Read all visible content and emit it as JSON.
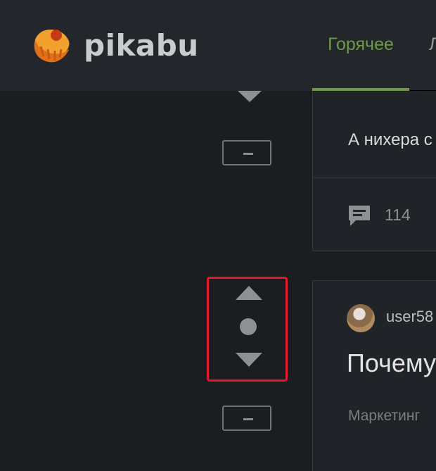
{
  "header": {
    "brand": "pikabu",
    "tabs": [
      {
        "label": "Горячее",
        "active": true
      },
      {
        "label": "Л",
        "active": false
      }
    ]
  },
  "posts": [
    {
      "title": "А нихера с",
      "comments_count": "114"
    },
    {
      "author": "user58",
      "title": "Почему",
      "tag": "Маркетинг"
    }
  ],
  "colors": {
    "accent_green": "#6b9a4a",
    "highlight_red": "#e0192c",
    "background": "#1b1d20",
    "header_bg": "#23262a"
  },
  "icons": {
    "logo": "pikabu-cupcake-icon",
    "comment": "comment-bubble-icon",
    "vote_up": "triangle-up-icon",
    "vote_down": "triangle-down-icon",
    "collapse": "minus-icon"
  }
}
